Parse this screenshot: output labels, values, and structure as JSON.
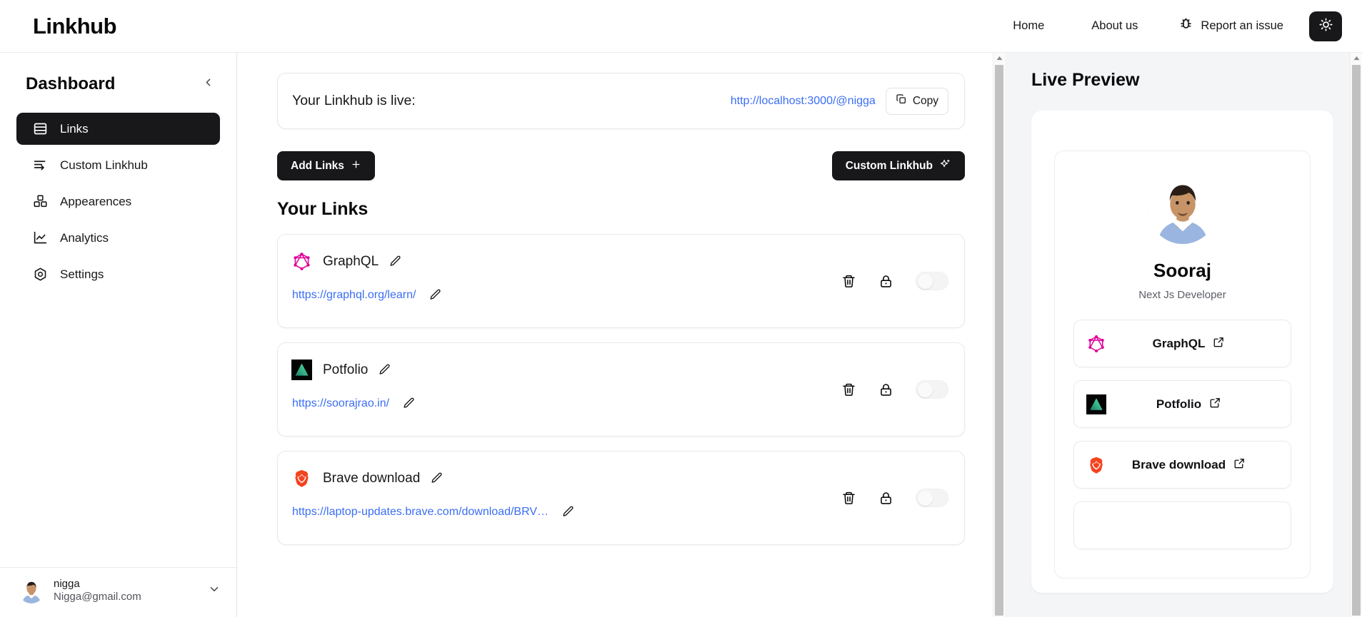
{
  "header": {
    "logo": "Linkhub",
    "nav": [
      {
        "label": "Home",
        "name": "nav-home"
      },
      {
        "label": "About us",
        "name": "nav-about-us"
      }
    ],
    "report_issue_label": "Report an issue",
    "theme_icon": "sun-icon"
  },
  "sidebar": {
    "title": "Dashboard",
    "collapse_icon": "chevron-left-icon",
    "items": [
      {
        "label": "Links",
        "icon": "rows-icon",
        "active": true
      },
      {
        "label": "Custom Linkhub",
        "icon": "list-arrow-icon",
        "active": false
      },
      {
        "label": "Appearences",
        "icon": "blocks-icon",
        "active": false
      },
      {
        "label": "Analytics",
        "icon": "line-chart-icon",
        "active": false
      },
      {
        "label": "Settings",
        "icon": "gear-hex-icon",
        "active": false
      }
    ],
    "user": {
      "name": "nigga",
      "email": "Nigga@gmail.com",
      "chevron_icon": "chevron-down-icon"
    }
  },
  "main": {
    "live_banner": {
      "label": "Your Linkhub is live:",
      "url": "http://localhost:3000/@nigga",
      "copy_label": "Copy",
      "copy_icon": "copy-icon"
    },
    "add_links_label": "Add Links",
    "add_links_icon": "plus-icon",
    "custom_linkhub_label": "Custom Linkhub",
    "custom_linkhub_icon": "sparkles-icon",
    "section_title": "Your Links",
    "links": [
      {
        "title": "GraphQL",
        "url": "https://graphql.org/learn/",
        "icon": "graphql-icon",
        "icon_color": "#e10098",
        "enabled": false
      },
      {
        "title": "Potfolio",
        "url": "https://soorajrao.in/",
        "icon": "portfolio-triangle-icon",
        "icon_color": "#2fd6a0",
        "enabled": false
      },
      {
        "title": "Brave download",
        "url": "https://laptop-updates.brave.com/download/BRV…",
        "icon": "brave-icon",
        "icon_color": "#fb542b",
        "enabled": false
      }
    ],
    "row_actions": {
      "delete_icon": "trash-icon",
      "lock_icon": "lock-icon",
      "toggle": "visibility-toggle"
    }
  },
  "preview": {
    "title": "Live Preview",
    "profile_name": "Sooraj",
    "profile_bio": "Next Js Developer",
    "links": [
      {
        "label": "GraphQL",
        "icon": "graphql-icon",
        "external_icon": "external-link-icon"
      },
      {
        "label": "Potfolio",
        "icon": "portfolio-triangle-icon",
        "external_icon": "external-link-icon"
      },
      {
        "label": "Brave download",
        "icon": "brave-icon",
        "external_icon": "external-link-icon"
      }
    ]
  },
  "colors": {
    "accent_dark": "#18181b",
    "link_blue": "#3b6ef5",
    "graphql_pink": "#e10098",
    "brave_orange": "#fb542b",
    "preview_bg": "#f4f5f7"
  }
}
